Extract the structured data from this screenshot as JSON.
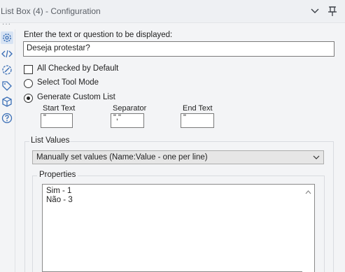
{
  "header": {
    "title": "List Box (4) - Configuration"
  },
  "sidebar": {
    "icons": [
      "gear-icon",
      "code-icon",
      "annotation-icon",
      "tag-icon",
      "cube-icon",
      "help-icon"
    ]
  },
  "prompt": {
    "label": "Enter the text or question to be displayed:",
    "value": "Deseja protestar?"
  },
  "options": {
    "all_checked": {
      "label": "All Checked by Default",
      "checked": false
    },
    "select_tool_mode": {
      "label": "Select Tool Mode",
      "selected": false
    },
    "generate_custom_list": {
      "label": "Generate Custom List",
      "selected": true
    }
  },
  "custom_list": {
    "start_text_label": "Start Text",
    "start_text_value": "\"",
    "separator_label": "Separator",
    "separator_value": "\",\"",
    "end_text_label": "End Text",
    "end_text_value": "\""
  },
  "list_values": {
    "title": "List Values",
    "dropdown_value": "Manually set values (Name:Value - one per line)",
    "properties_title": "Properties",
    "lines": [
      "Sim - 1",
      "Não - 3"
    ]
  },
  "colors": {
    "accent": "#3b6fb6",
    "header_bg": "#eef0f3",
    "panel_bg": "#f3f4f6"
  }
}
